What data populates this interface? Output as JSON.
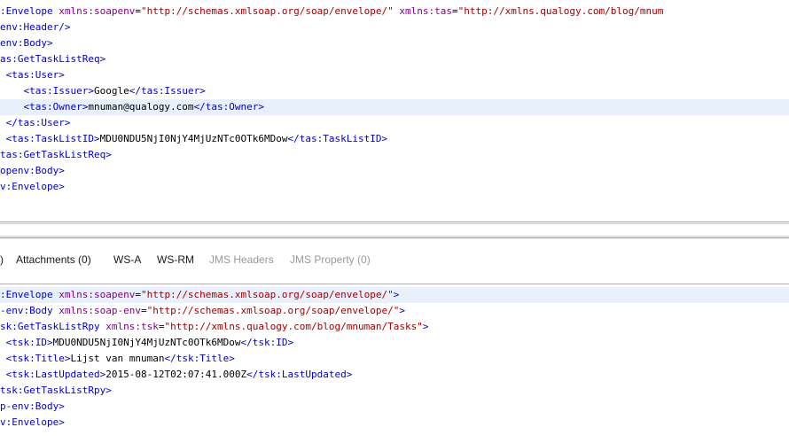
{
  "request": {
    "lines": [
      [
        {
          "t": ":Envelope",
          "c": "c-tag"
        },
        {
          "t": " ",
          "c": "c-text"
        },
        {
          "t": "xmlns:soapenv",
          "c": "c-attr"
        },
        {
          "t": "=",
          "c": "c-text"
        },
        {
          "t": "\"http://schemas.xmlsoap.org/soap/envelope/\"",
          "c": "c-val"
        },
        {
          "t": " ",
          "c": "c-text"
        },
        {
          "t": "xmlns:tas",
          "c": "c-attr"
        },
        {
          "t": "=",
          "c": "c-text"
        },
        {
          "t": "\"http://xmlns.qualogy.com/blog/mnum",
          "c": "c-val"
        }
      ],
      [
        {
          "t": "env:Header/>",
          "c": "c-tag"
        }
      ],
      [
        {
          "t": "env:Body>",
          "c": "c-tag"
        }
      ],
      [
        {
          "t": "as:GetTaskListReq>",
          "c": "c-tag"
        }
      ],
      [
        {
          "t": " <tas:User>",
          "c": "c-tag"
        }
      ],
      [
        {
          "t": "    <tas:Issuer>",
          "c": "c-tag"
        },
        {
          "t": "Google",
          "c": "c-text"
        },
        {
          "t": "</tas:Issuer>",
          "c": "c-tag"
        }
      ],
      [
        {
          "t": "    <tas:Owner>",
          "c": "c-tag"
        },
        {
          "t": "mnuman@qualogy.com",
          "c": "c-text"
        },
        {
          "t": "</tas:Owner>",
          "c": "c-tag"
        }
      ],
      [
        {
          "t": " </tas:User>",
          "c": "c-tag"
        }
      ],
      [
        {
          "t": " <tas:TaskListID>",
          "c": "c-tag"
        },
        {
          "t": "MDU0NDU5NjI0NjY4MjUzNTc0OTk6MDow",
          "c": "c-text"
        },
        {
          "t": "</tas:TaskListID>",
          "c": "c-tag"
        }
      ],
      [
        {
          "t": "tas:GetTaskListReq>",
          "c": "c-tag"
        }
      ],
      [
        {
          "t": "openv:Body>",
          "c": "c-tag"
        }
      ],
      [
        {
          "t": "v:Envelope>",
          "c": "c-tag"
        }
      ]
    ]
  },
  "tabs": [
    {
      "label": ")",
      "disabled": false
    },
    {
      "label": "Attachments (0)",
      "disabled": false
    },
    {
      "label": "WS-A",
      "disabled": false
    },
    {
      "label": "WS-RM",
      "disabled": false
    },
    {
      "label": "JMS Headers",
      "disabled": true
    },
    {
      "label": "JMS Property (0)",
      "disabled": true
    }
  ],
  "response": {
    "lines": [
      [
        {
          "t": ":Envelope",
          "c": "c-tag"
        },
        {
          "t": " ",
          "c": "c-text"
        },
        {
          "t": "xmlns:soapenv",
          "c": "c-attr"
        },
        {
          "t": "=",
          "c": "c-text"
        },
        {
          "t": "\"http://schemas.xmlsoap.org/soap/envelope/\"",
          "c": "c-val"
        },
        {
          "t": ">",
          "c": "c-tag"
        }
      ],
      [
        {
          "t": "-env:Body",
          "c": "c-tag"
        },
        {
          "t": " ",
          "c": "c-text"
        },
        {
          "t": "xmlns:soap-env",
          "c": "c-attr"
        },
        {
          "t": "=",
          "c": "c-text"
        },
        {
          "t": "\"http://schemas.xmlsoap.org/soap/envelope/\"",
          "c": "c-val"
        },
        {
          "t": ">",
          "c": "c-tag"
        }
      ],
      [
        {
          "t": "sk:GetTaskListRpy",
          "c": "c-tag"
        },
        {
          "t": " ",
          "c": "c-text"
        },
        {
          "t": "xmlns:tsk",
          "c": "c-attr"
        },
        {
          "t": "=",
          "c": "c-text"
        },
        {
          "t": "\"http://xmlns.qualogy.com/blog/mnuman/Tasks\"",
          "c": "c-val"
        },
        {
          "t": ">",
          "c": "c-tag"
        }
      ],
      [
        {
          "t": " <tsk:ID>",
          "c": "c-tag"
        },
        {
          "t": "MDU0NDU5NjI0NjY4MjUzNTc0OTk6MDow",
          "c": "c-text"
        },
        {
          "t": "</tsk:ID>",
          "c": "c-tag"
        }
      ],
      [
        {
          "t": " <tsk:Title>",
          "c": "c-tag"
        },
        {
          "t": "Lijst van mnuman",
          "c": "c-text"
        },
        {
          "t": "</tsk:Title>",
          "c": "c-tag"
        }
      ],
      [
        {
          "t": " <tsk:LastUpdated>",
          "c": "c-tag"
        },
        {
          "t": "2015-08-12T02:07:41.000Z",
          "c": "c-text"
        },
        {
          "t": "</tsk:LastUpdated>",
          "c": "c-tag"
        }
      ],
      [
        {
          "t": "tsk:GetTaskListRpy>",
          "c": "c-tag"
        }
      ],
      [
        {
          "t": "p-env:Body>",
          "c": "c-tag"
        }
      ],
      [
        {
          "t": "v:Envelope>",
          "c": "c-tag"
        }
      ]
    ]
  }
}
